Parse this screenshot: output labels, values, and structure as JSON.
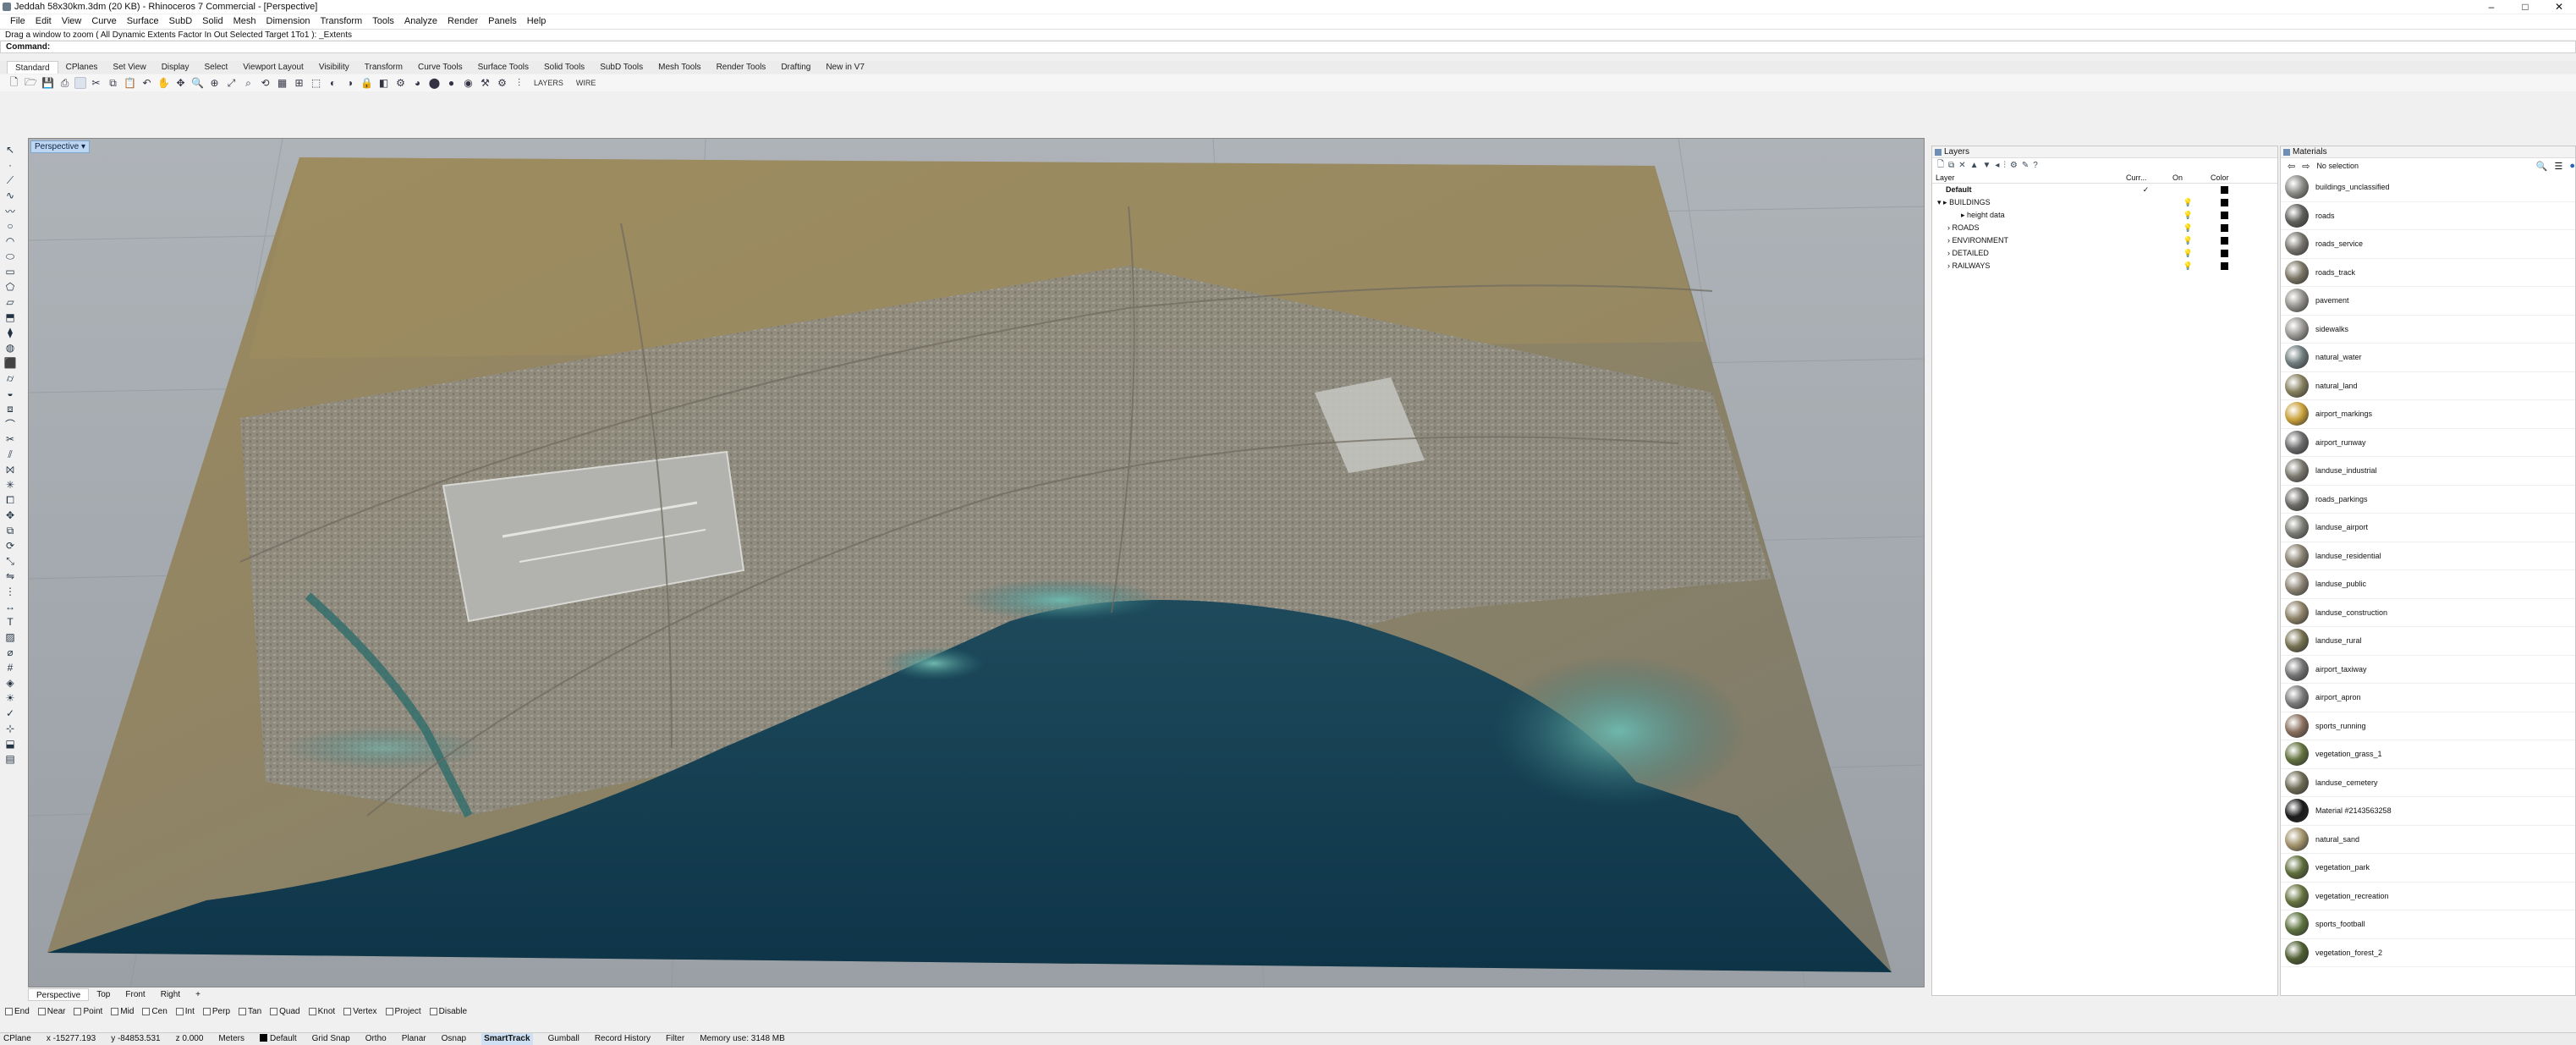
{
  "window": {
    "title": "Jeddah 58x30km.3dm (20 KB) - Rhinoceros 7 Commercial - [Perspective]",
    "controls": [
      "–",
      "□",
      "✕"
    ]
  },
  "menu": [
    "File",
    "Edit",
    "View",
    "Curve",
    "Surface",
    "SubD",
    "Solid",
    "Mesh",
    "Dimension",
    "Transform",
    "Tools",
    "Analyze",
    "Render",
    "Panels",
    "Help"
  ],
  "command": {
    "history": "Drag a window to zoom ( All  Dynamic  Extents  Factor  In  Out  Selected  Target  1To1 ): _Extents",
    "prompt": "Command:"
  },
  "toolbar_tabs": [
    "Standard",
    "CPlanes",
    "Set View",
    "Display",
    "Select",
    "Viewport Layout",
    "Visibility",
    "Transform",
    "Curve Tools",
    "Surface Tools",
    "Solid Tools",
    "SubD Tools",
    "Mesh Tools",
    "Render Tools",
    "Drafting",
    "New in V7"
  ],
  "toolbar_text": [
    "LAYERS",
    "WIRE"
  ],
  "viewport": {
    "label": "Perspective"
  },
  "viewport_tabs": [
    "Perspective",
    "Top",
    "Front",
    "Right",
    "+"
  ],
  "osnaps": [
    "End",
    "Near",
    "Point",
    "Mid",
    "Cen",
    "Int",
    "Perp",
    "Tan",
    "Quad",
    "Knot",
    "Vertex"
  ],
  "osnap_extra": [
    "Project",
    "Disable"
  ],
  "status": {
    "cplane": "CPlane",
    "x": "x -15277.193",
    "y": "y -84853.531",
    "z": "z 0.000",
    "units": "Meters",
    "layer": "Default",
    "toggles": [
      "Grid Snap",
      "Ortho",
      "Planar",
      "Osnap",
      "SmartTrack",
      "Gumball",
      "Record History",
      "Filter"
    ],
    "active_toggle": "SmartTrack",
    "memory": "Memory use: 3148 MB"
  },
  "layers_panel": {
    "title": "Layers",
    "columns": [
      "Layer",
      "Curr...",
      "On",
      "Color"
    ],
    "rows": [
      {
        "name": "Default",
        "bold": true,
        "current": "✓",
        "indent": 0
      },
      {
        "name": "BUILDINGS",
        "expander": "▾",
        "indent": 0
      },
      {
        "name": "height data",
        "indent": 1
      },
      {
        "name": "ROADS",
        "expander": "›",
        "indent": 0
      },
      {
        "name": "ENVIRONMENT",
        "expander": "›",
        "indent": 0
      },
      {
        "name": "DETAILED",
        "expander": "›",
        "indent": 0
      },
      {
        "name": "RAILWAYS",
        "expander": "›",
        "indent": 0
      }
    ]
  },
  "materials_panel": {
    "title": "Materials",
    "selection": "No selection",
    "items": [
      {
        "name": "buildings_unclassified",
        "color": "#8a8a86"
      },
      {
        "name": "roads",
        "color": "#5f5f5c"
      },
      {
        "name": "roads_service",
        "color": "#77746e"
      },
      {
        "name": "roads_track",
        "color": "#7a7565"
      },
      {
        "name": "pavement",
        "color": "#93918c"
      },
      {
        "name": "sidewalks",
        "color": "#9a9894"
      },
      {
        "name": "natural_water",
        "color": "#6f7c7d"
      },
      {
        "name": "natural_land",
        "color": "#86805f"
      },
      {
        "name": "airport_markings",
        "color": "#c9a13a"
      },
      {
        "name": "airport_runway",
        "color": "#6b6b6b"
      },
      {
        "name": "landuse_industrial",
        "color": "#7a776e"
      },
      {
        "name": "roads_parkings",
        "color": "#6c6b67"
      },
      {
        "name": "landuse_airport",
        "color": "#7d7d76"
      },
      {
        "name": "landuse_residential",
        "color": "#888070"
      },
      {
        "name": "landuse_public",
        "color": "#8b8272"
      },
      {
        "name": "landuse_construction",
        "color": "#8d8167"
      },
      {
        "name": "landuse_rural",
        "color": "#74704f"
      },
      {
        "name": "airport_taxiway",
        "color": "#737373"
      },
      {
        "name": "airport_apron",
        "color": "#7b7b7b"
      },
      {
        "name": "sports_running",
        "color": "#8a6f5e"
      },
      {
        "name": "vegetation_grass_1",
        "color": "#62713f"
      },
      {
        "name": "landuse_cemetery",
        "color": "#6e6b55"
      },
      {
        "name": "Material #2143563258",
        "color": "#1b1b1b"
      },
      {
        "name": "natural_sand",
        "color": "#a2926b"
      },
      {
        "name": "vegetation_park",
        "color": "#5d6d3b"
      },
      {
        "name": "vegetation_recreation",
        "color": "#66733f"
      },
      {
        "name": "sports_football",
        "color": "#5e7340"
      },
      {
        "name": "vegetation_forest_2",
        "color": "#4f5f33"
      }
    ]
  }
}
